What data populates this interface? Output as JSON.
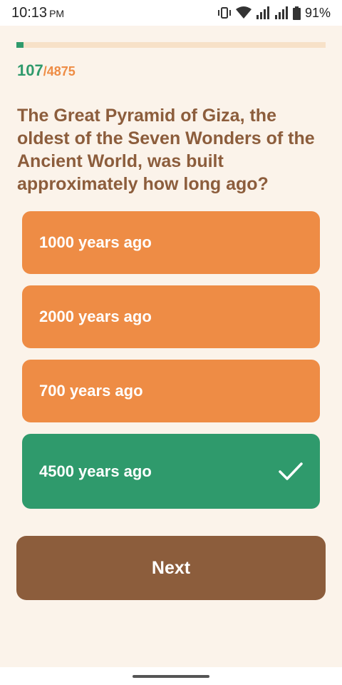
{
  "status_bar": {
    "time": "10:13",
    "ampm": "PM",
    "battery": "91%",
    "icons": [
      "vibrate-icon",
      "wifi-icon",
      "signal-icon",
      "signal-icon",
      "battery-icon"
    ]
  },
  "progress": {
    "value": 0.022,
    "fill_color": "#2f9a6c",
    "track_color": "#f7e1c8"
  },
  "counter": {
    "current": "107",
    "total": "/4875"
  },
  "question": "The Great Pyramid of Giza, the oldest of the Seven Wonders of the Ancient World, was built approximately how long ago?",
  "options": [
    {
      "label": "1000 years ago",
      "state": "default"
    },
    {
      "label": "2000 years ago",
      "state": "default"
    },
    {
      "label": "700 years ago",
      "state": "default"
    },
    {
      "label": "4500 years ago",
      "state": "correct",
      "icon": "check-icon"
    }
  ],
  "colors": {
    "background": "#fbf3ea",
    "option": "#ee8c45",
    "correct": "#2f9a6c",
    "primary": "#8c5d3c"
  },
  "next_label": "Next"
}
